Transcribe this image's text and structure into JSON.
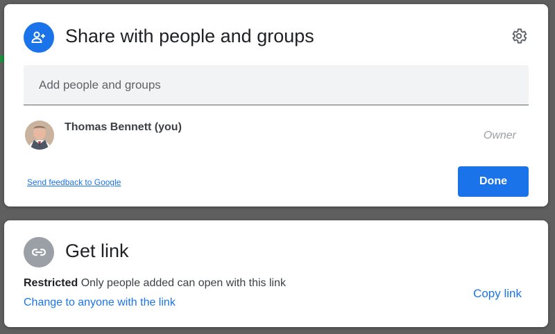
{
  "share_dialog": {
    "title": "Share with people and groups",
    "add_placeholder": "Add people and groups",
    "person": {
      "name": "Thomas Bennett (you)",
      "role": "Owner"
    },
    "feedback_link": "Send feedback to Google",
    "done_label": "Done",
    "icons": {
      "header": "person-add-icon",
      "settings": "gear-icon"
    }
  },
  "link_dialog": {
    "title": "Get link",
    "restriction_label": "Restricted",
    "restriction_desc": "Only people added can open with this link",
    "change_link": "Change to anyone with the link",
    "copy_link": "Copy link",
    "icons": {
      "header": "link-icon"
    }
  },
  "colors": {
    "accent": "#1a73e8",
    "link_icon_bg": "#9aa0a6",
    "backdrop": "#5f5f5f"
  }
}
